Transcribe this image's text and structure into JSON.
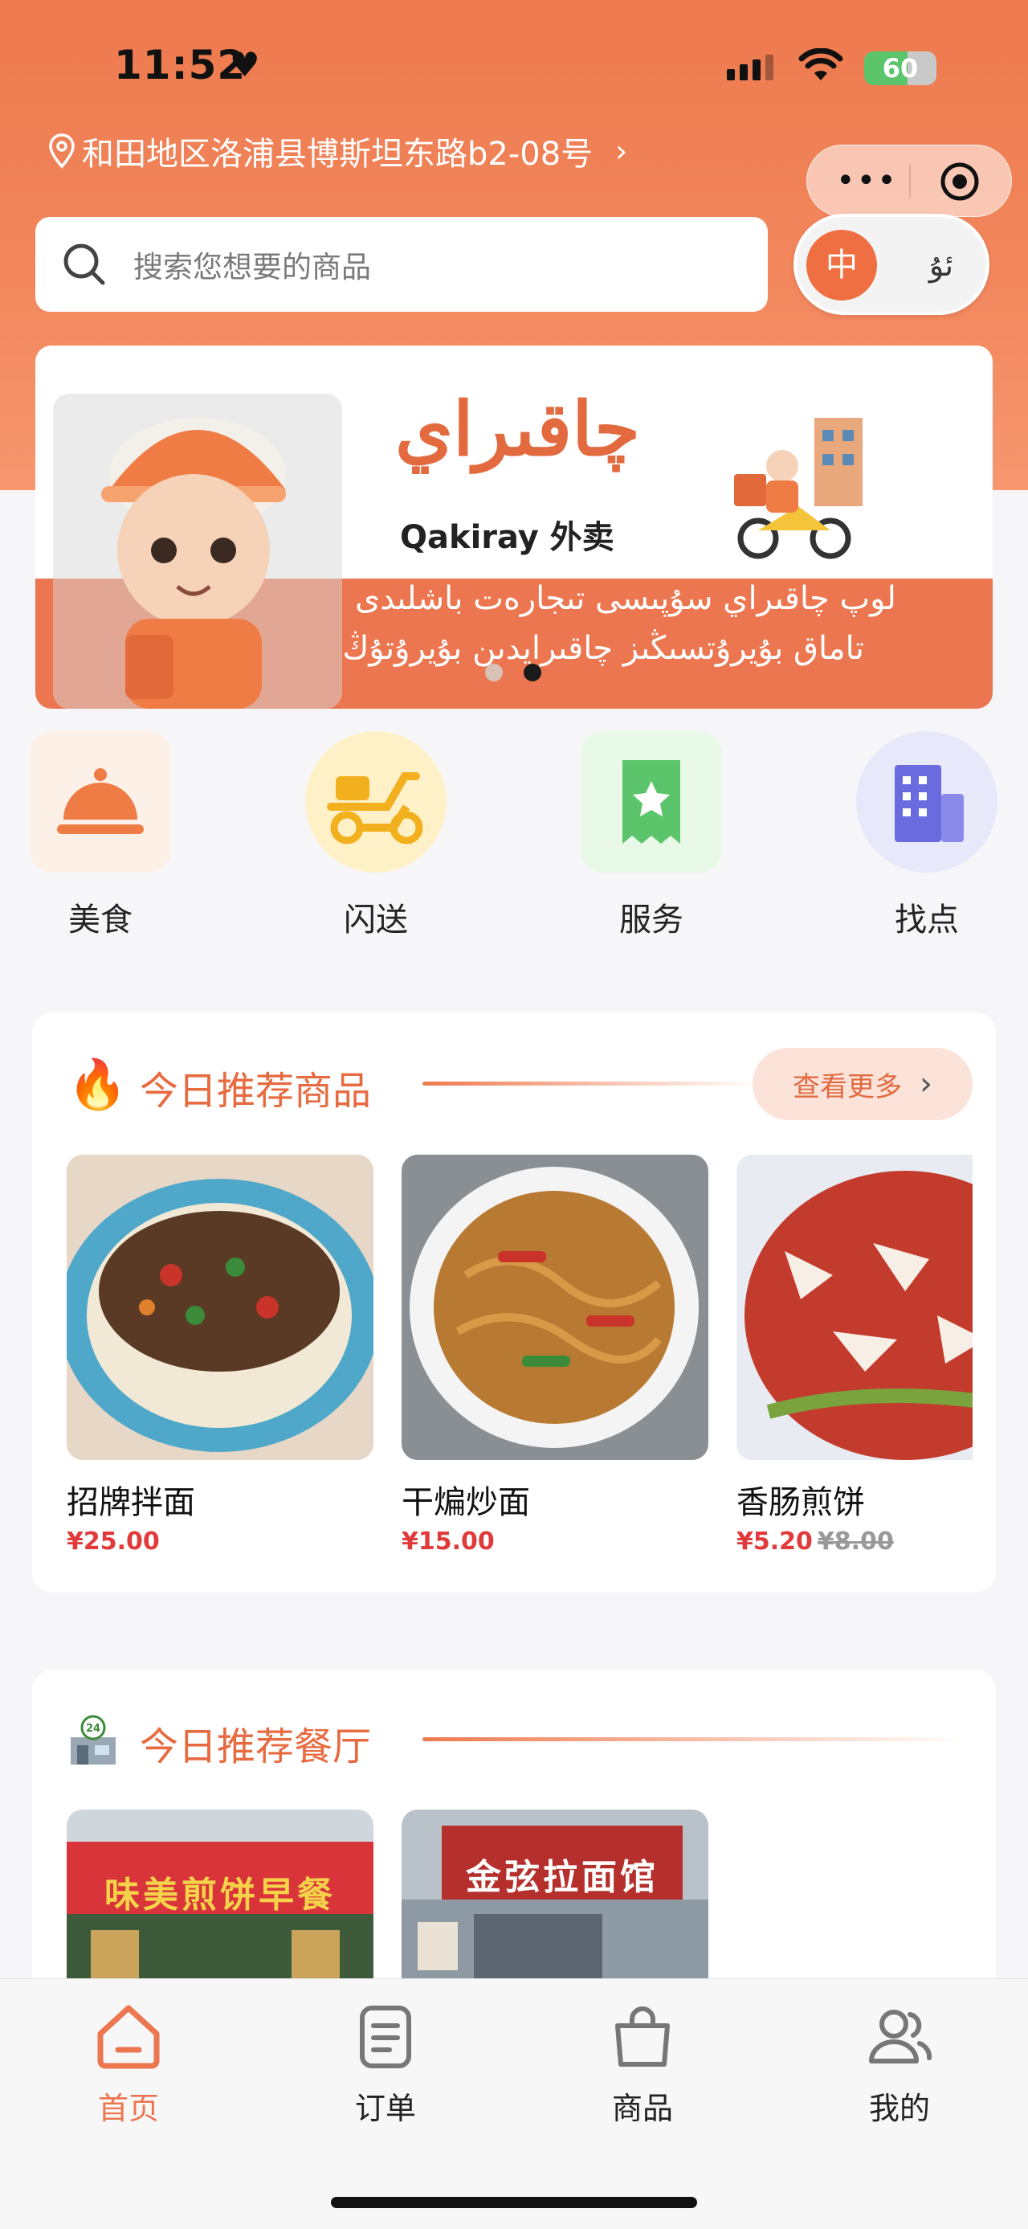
{
  "status_bar": {
    "time": "11:52",
    "battery": "60",
    "battery_level": 0.6
  },
  "location": {
    "address": "和田地区洛浦县博斯坦东路b2-08号"
  },
  "search": {
    "placeholder": "搜索您想要的商品"
  },
  "language_toggle": {
    "active": "中",
    "inactive": "ئۇ"
  },
  "banner": {
    "brand_uyghur": "چاقىراي",
    "brand_latin": "Qakiray 外卖",
    "line1": "لوپ چاقىراي سۇپىسى تىجارەت باشلىدى",
    "line2": "تاماق بۇيرۇتسىڭىز چاقىرايدىن بۇيرۇتۇڭ",
    "page_count": 2,
    "current_page": 2
  },
  "categories": [
    {
      "label": "美食",
      "icon": "food-cloche-icon"
    },
    {
      "label": "闪送",
      "icon": "delivery-scooter-icon"
    },
    {
      "label": "服务",
      "icon": "service-ticket-icon"
    },
    {
      "label": "找点",
      "icon": "building-icon"
    }
  ],
  "recommended_products": {
    "title": "今日推荐商品",
    "more_label": "查看更多",
    "items": [
      {
        "name": "招牌拌面",
        "price": "¥25.00",
        "original_price": ""
      },
      {
        "name": "干煸炒面",
        "price": "¥15.00",
        "original_price": ""
      },
      {
        "name": "香肠煎饼",
        "price": "¥5.20",
        "original_price": "¥8.00"
      }
    ]
  },
  "recommended_restaurants": {
    "title": "今日推荐餐厅",
    "items": [
      {
        "sign": "味美煎饼早餐"
      },
      {
        "sign": "金弦拉面馆"
      }
    ]
  },
  "tabbar": [
    {
      "label": "首页",
      "icon": "home-icon",
      "active": true
    },
    {
      "label": "订单",
      "icon": "order-list-icon",
      "active": false
    },
    {
      "label": "商品",
      "icon": "shopping-bag-icon",
      "active": false
    },
    {
      "label": "我的",
      "icon": "user-icon",
      "active": false
    }
  ],
  "colors": {
    "accent": "#ec7650",
    "price": "#e03a3a"
  }
}
